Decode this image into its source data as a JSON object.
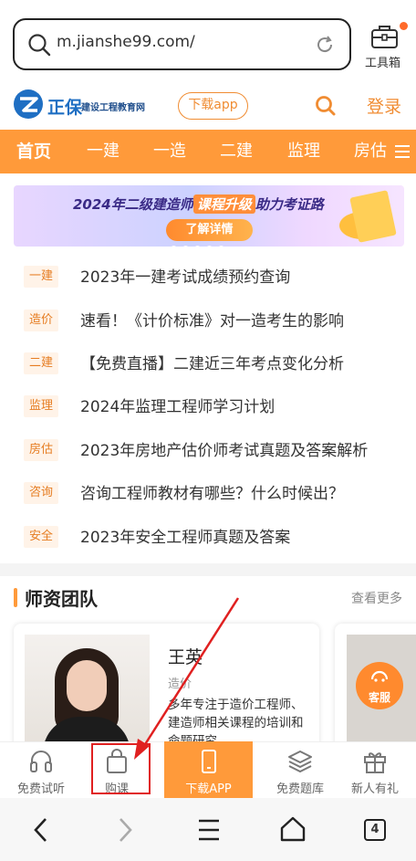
{
  "browser": {
    "url": "m.jianshe99.com/",
    "toolbox_label": "工具箱"
  },
  "site_header": {
    "logo_brand": "正保",
    "logo_subtitle": "建设工程教育网",
    "download_app_label": "下载app",
    "login_label": "登录"
  },
  "nav": {
    "items": [
      "首页",
      "一建",
      "一造",
      "二建",
      "监理",
      "房估"
    ],
    "active_index": 0
  },
  "banner": {
    "title_prefix": "2024年二级建造师",
    "title_highlight": "课程升级",
    "title_suffix": "助力考证路",
    "button_label": "了解详情"
  },
  "news": [
    {
      "tag": "一建",
      "title": "2023年一建考试成绩预约查询"
    },
    {
      "tag": "造价",
      "title": "速看！《计价标准》对一造考生的影响"
    },
    {
      "tag": "二建",
      "title": "【免费直播】二建近三年考点变化分析"
    },
    {
      "tag": "监理",
      "title": "2024年监理工程师学习计划"
    },
    {
      "tag": "房估",
      "title": "2023年房地产估价师考试真题及答案解析"
    },
    {
      "tag": "咨询",
      "title": "咨询工程师教材有哪些？什么时候出？"
    },
    {
      "tag": "安全",
      "title": "2023年安全工程师真题及答案"
    }
  ],
  "teachers": {
    "section_title": "师资团队",
    "see_more_label": "查看更多",
    "items": [
      {
        "name": "王英",
        "subject": "造价",
        "description": "多年专注于造价工程师、建造师相关课程的培训和命题研究"
      }
    ],
    "service_label": "客服"
  },
  "tabbar": {
    "items": [
      {
        "label": "免费试听",
        "icon": "headphones-icon"
      },
      {
        "label": "购课",
        "icon": "shopping-bag-icon"
      },
      {
        "label": "下载APP",
        "icon": "phone-icon"
      },
      {
        "label": "免费题库",
        "icon": "layers-icon"
      },
      {
        "label": "新人有礼",
        "icon": "gift-icon"
      }
    ]
  },
  "system_nav": {
    "tab_count": "4"
  },
  "colors": {
    "accent": "#ff9a3a",
    "brand_blue": "#1f6fc3",
    "annotation_red": "#e02020"
  }
}
